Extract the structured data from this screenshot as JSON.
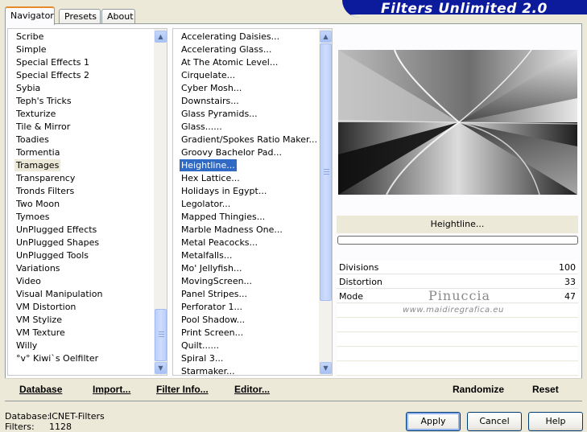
{
  "app": {
    "title": "Filters Unlimited 2.0"
  },
  "tabs": [
    {
      "label": "Navigator"
    },
    {
      "label": "Presets"
    },
    {
      "label": "About"
    }
  ],
  "categories": {
    "selected": "Tramages",
    "items": [
      "Scribe",
      "Simple",
      "Special Effects 1",
      "Special Effects 2",
      "Sybia",
      "Teph's Tricks",
      "Texturize",
      "Tile & Mirror",
      "Toadies",
      "Tormentia",
      "Tramages",
      "Transparency",
      "Tronds Filters",
      "Two Moon",
      "Tymoes",
      "UnPlugged Effects",
      "UnPlugged Shapes",
      "UnPlugged Tools",
      "Variations",
      "Video",
      "Visual Manipulation",
      "VM Distortion",
      "VM Stylize",
      "VM Texture",
      "Willy",
      "°v° Kiwi`s Oelfilter"
    ]
  },
  "filters": {
    "selected": "Heightline...",
    "items": [
      "Accelerating Daisies...",
      "Accelerating Glass...",
      "At The Atomic Level...",
      "Cirquelate...",
      "Cyber Mosh...",
      "Downstairs...",
      "Glass Pyramids...",
      "Glass......",
      "Gradient/Spokes Ratio Maker...",
      "Groovy Bachelor Pad...",
      "Heightline...",
      "Hex Lattice...",
      "Holidays in Egypt...",
      "Legolator...",
      "Mapped Thingies...",
      "Marble Madness One...",
      "Metal Peacocks...",
      "Metalfalls...",
      "Mo' Jellyfish...",
      "MovingScreen...",
      "Panel Stripes...",
      "Perforator 1...",
      "Pool Shadow...",
      "Print Screen...",
      "Quilt......",
      "Spiral 3...",
      "Starmaker..."
    ]
  },
  "preview": {
    "filter_name": "Heightline...",
    "progress": 0
  },
  "params": [
    {
      "label": "Divisions",
      "value": "100"
    },
    {
      "label": "Distortion",
      "value": "33"
    },
    {
      "label": "Mode",
      "value": "47"
    }
  ],
  "watermark": {
    "name": "Pinuccia",
    "url": "www.maidiregrafica.eu"
  },
  "commands": {
    "database": "Database",
    "import": "Import...",
    "filter_info": "Filter Info...",
    "editor": "Editor...",
    "randomize": "Randomize",
    "reset": "Reset"
  },
  "status": {
    "database_label": "Database:",
    "database_value": "ICNET-Filters",
    "filters_label": "Filters:",
    "filters_value": "1128"
  },
  "buttons": {
    "apply": "Apply",
    "cancel": "Cancel",
    "help": "Help"
  },
  "colors": {
    "banner": "#0c1a9c",
    "selection": "#316ac5",
    "tab_accent": "#e68b2c"
  }
}
